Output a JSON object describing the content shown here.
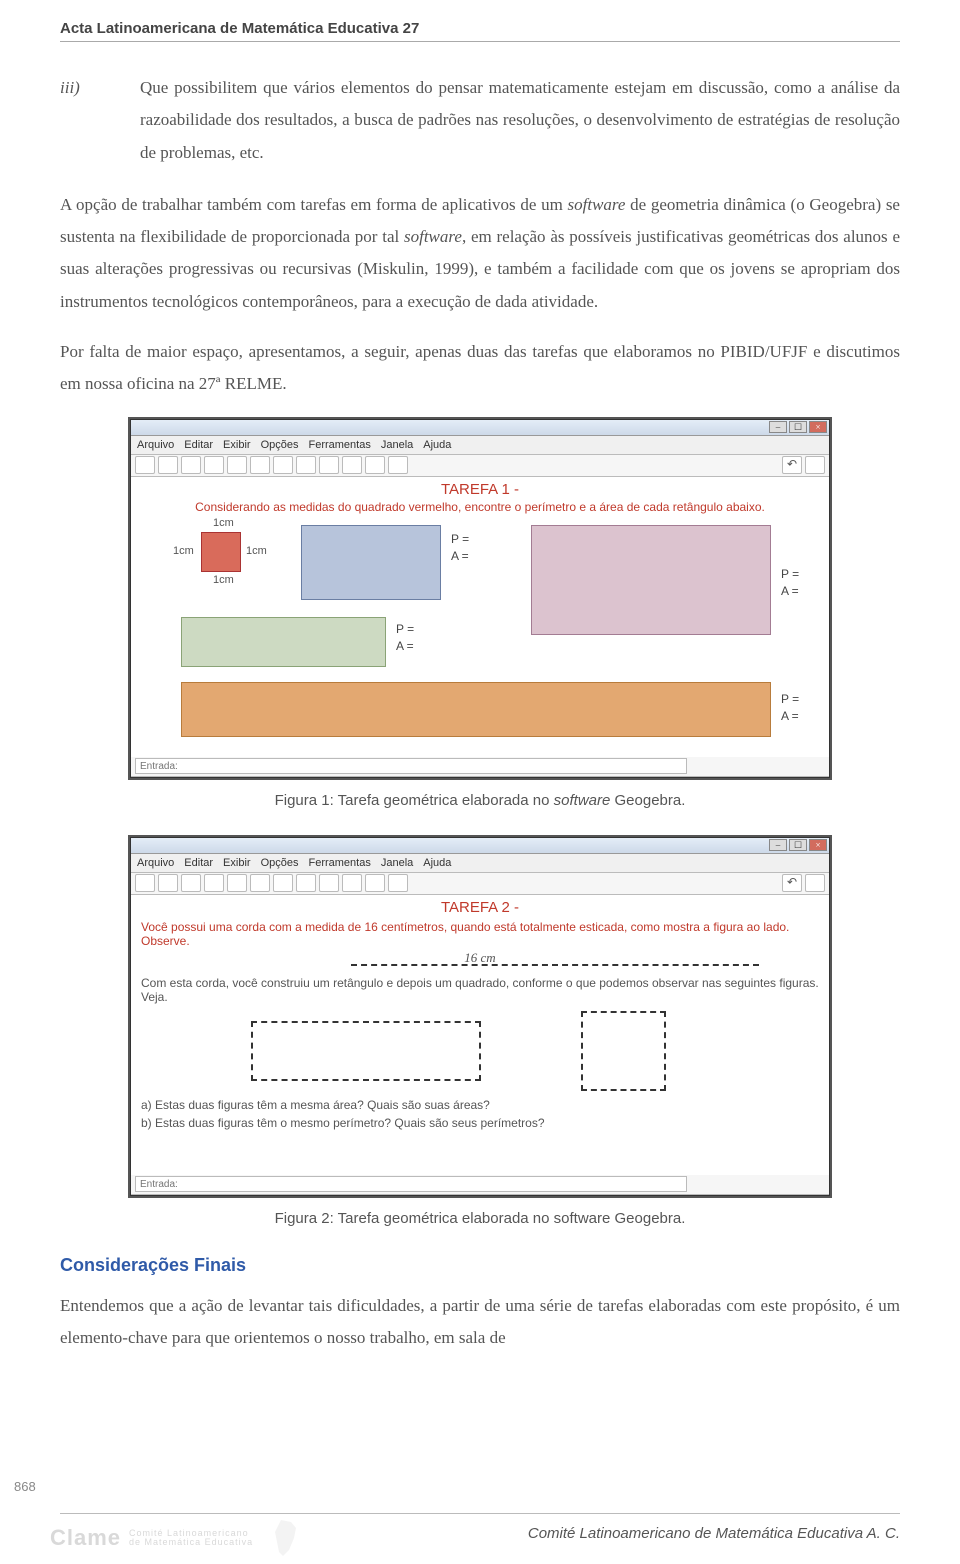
{
  "running_head": "Acta Latinoamericana de Matemática Educativa 27",
  "list": {
    "marker": "iii)",
    "text": "Que possibilitem que vários elementos do pensar matematicamente estejam em discussão, como a análise da razoabilidade dos resultados, a busca de padrões nas resoluções, o desenvolvimento de estratégias de resolução de problemas, etc."
  },
  "para1_a": "A opção de trabalhar também com tarefas em forma de aplicativos de um ",
  "para1_sw1": "software",
  "para1_b": " de geometria dinâmica (o Geogebra) se sustenta na flexibilidade de proporcionada por tal ",
  "para1_sw2": "software",
  "para1_c": ", em relação às possíveis justificativas geométricas dos alunos e suas alterações progressivas ou recursivas (Miskulin, 1999), e também a facilidade com que os jovens se apropriam dos instrumentos tecnológicos contemporâneos, para a execução de dada atividade.",
  "para2": "Por falta de maior espaço, apresentamos, a seguir, apenas duas das tarefas que elaboramos no PIBID/UFJF e discutimos em nossa oficina na 27ª RELME.",
  "geogebra_menu": [
    "Arquivo",
    "Editar",
    "Exibir",
    "Opções",
    "Ferramentas",
    "Janela",
    "Ajuda"
  ],
  "fig1": {
    "title": "TAREFA 1 -",
    "subtitle": "Considerando as medidas do quadrado vermelho, encontre o perímetro e a área de cada retângulo abaixo.",
    "dim_top": "1cm",
    "dim_left": "1cm",
    "dim_right": "1cm",
    "dim_bottom": "1cm",
    "pa_label_p": "P =",
    "pa_label_a": "A ="
  },
  "caption1_a": "Figura 1: Tarefa geométrica elaborada no ",
  "caption1_sw": "software",
  "caption1_b": " Geogebra.",
  "fig2": {
    "title": "TAREFA 2 -",
    "line1": "Você possui uma corda com a medida de 16 centímetros, quando está totalmente esticada, como mostra a figura ao lado. Observe.",
    "center_label": "16 cm",
    "line2": "Com esta corda, você construiu um retângulo e depois um quadrado, conforme o que podemos observar nas seguintes figuras. Veja.",
    "qa": "a) Estas duas figuras têm a mesma área? Quais são suas áreas?",
    "qb": "b) Estas duas figuras têm o mesmo perímetro? Quais são seus perímetros?"
  },
  "caption2": "Figura 2: Tarefa geométrica elaborada no software Geogebra.",
  "section_heading": "Considerações Finais",
  "para3": "Entendemos que a ação de levantar tais dificuldades, a partir de uma série de tarefas elaboradas com este propósito, é um elemento-chave para que orientemos o nosso trabalho, em sala de",
  "page_number": "868",
  "footer_text": "Comité Latinoamericano de Matemática Educativa A. C.",
  "footer_logo_main": "Clame",
  "footer_logo_small1": "Comité Latinoamericano",
  "footer_logo_small2": "de Matemática Educativa",
  "toolbar_input_placeholder": "Entrada:"
}
